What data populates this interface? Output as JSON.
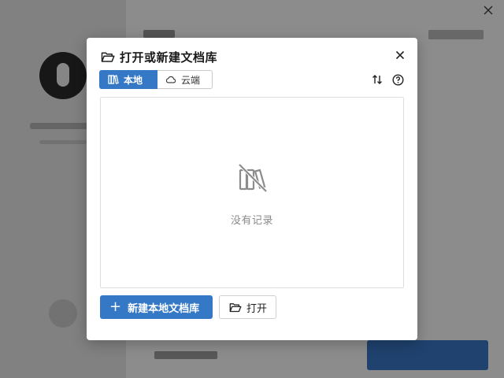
{
  "dialog": {
    "title": "打开或新建文档库",
    "title_icon": "folder-open-icon",
    "close_icon": "close-icon"
  },
  "tabs": [
    {
      "label": "本地",
      "icon": "library-icon",
      "active": true
    },
    {
      "label": "云端",
      "icon": "cloud-icon",
      "active": false
    }
  ],
  "toolbar": {
    "sort_icon": "sort-icon",
    "help_icon": "help-icon"
  },
  "content": {
    "empty_text": "没有记录",
    "empty_icon": "library-off-icon"
  },
  "actions": {
    "new_label": "新建本地文档库",
    "new_icon": "plus-icon",
    "open_label": "打开",
    "open_icon": "folder-open-icon"
  },
  "colors": {
    "accent": "#3478c6",
    "overlay": "rgba(0,0,0,0.45)",
    "empty_text": "#8a8a8a"
  }
}
